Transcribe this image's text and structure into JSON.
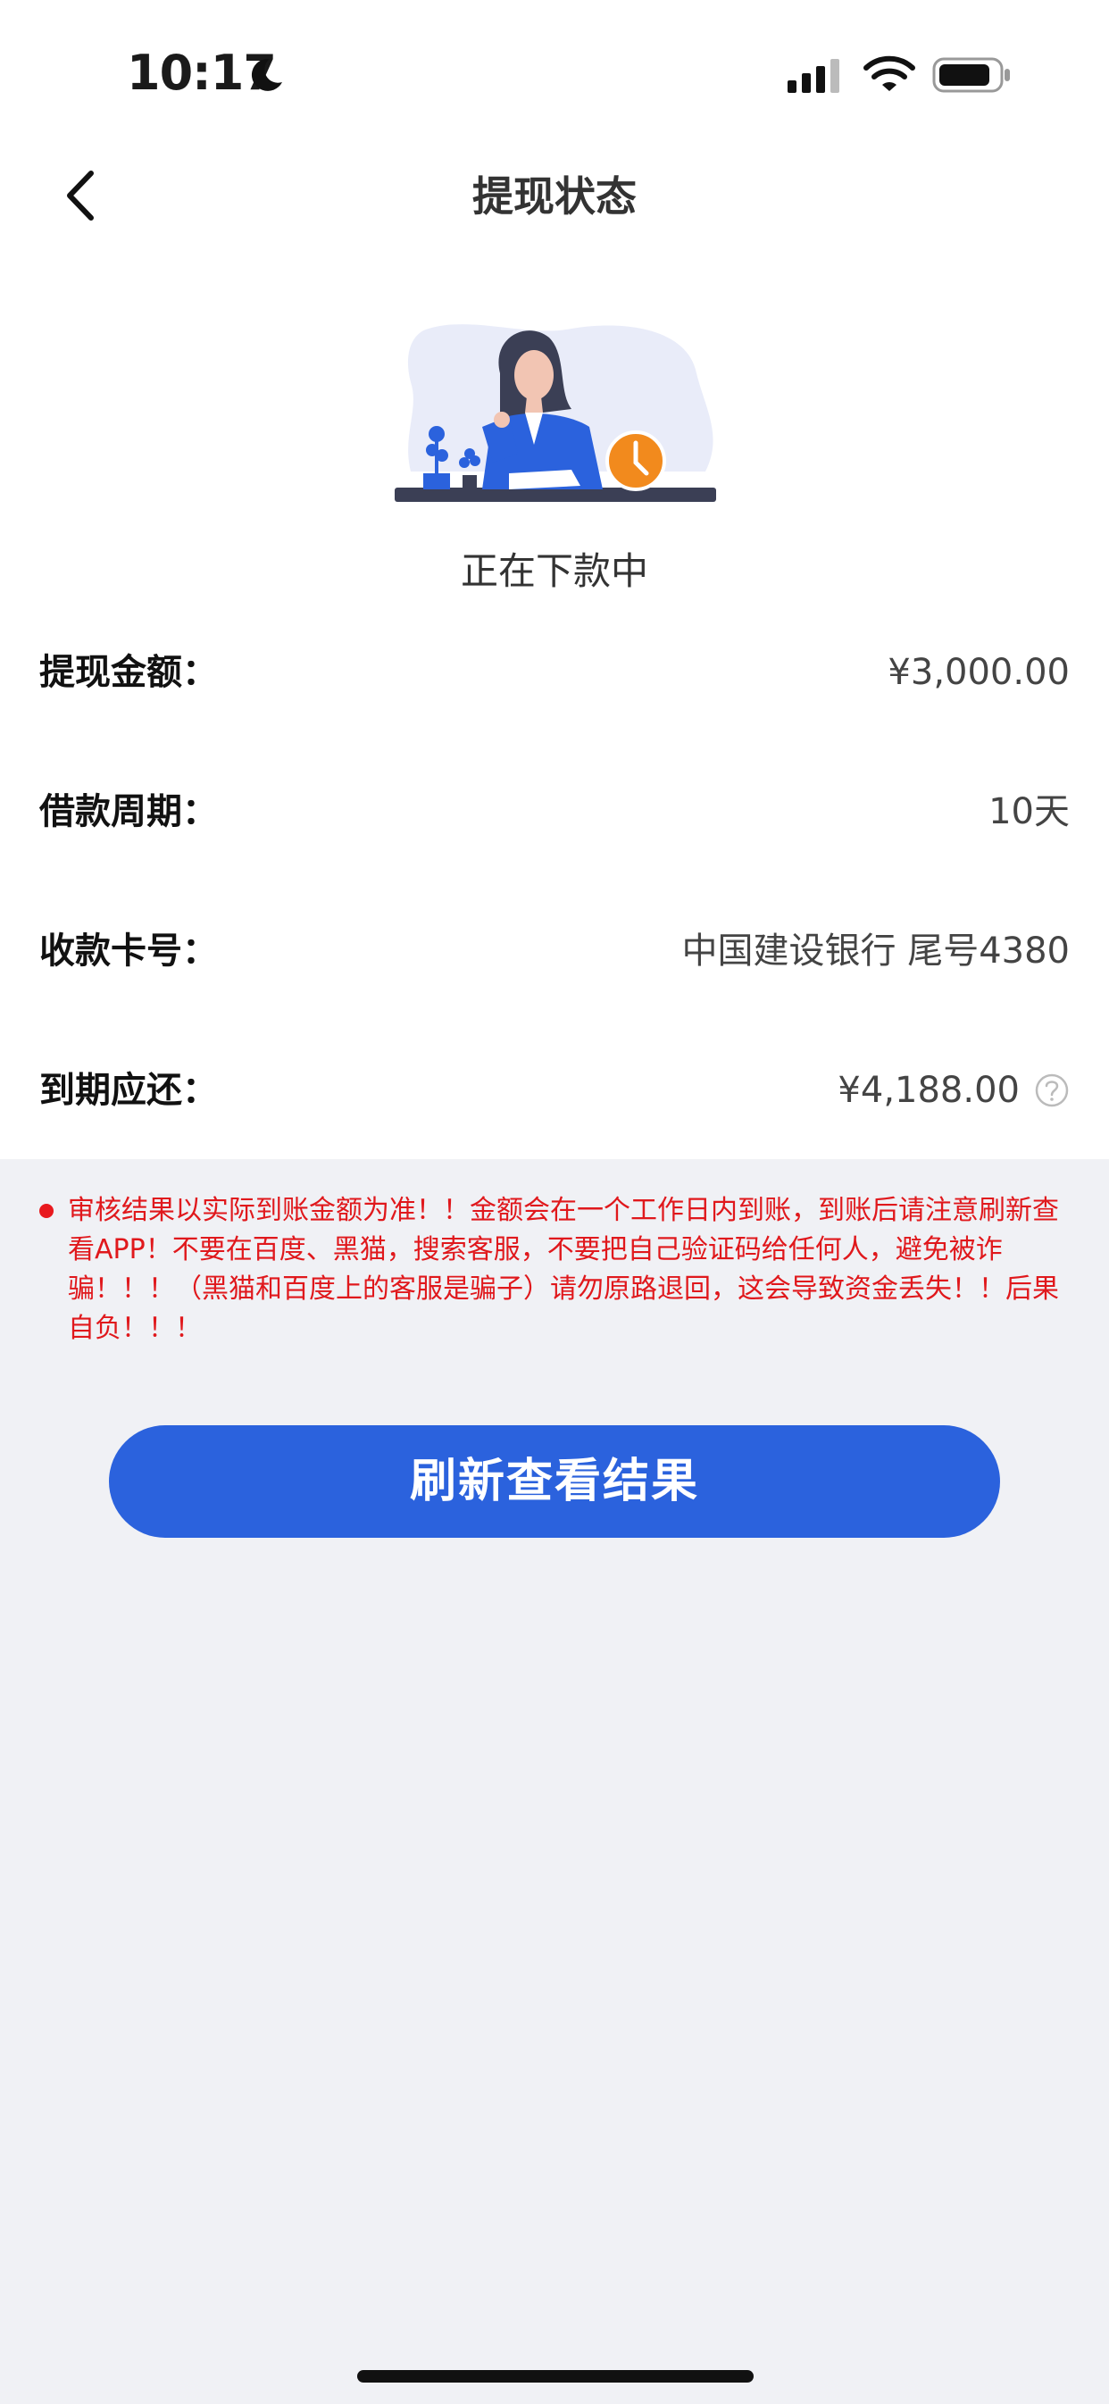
{
  "status_bar": {
    "time": "10:17"
  },
  "nav": {
    "title": "提现状态"
  },
  "status": {
    "text": "正在下款中"
  },
  "details": [
    {
      "label": "提现金额：",
      "value": "¥3,000.00"
    },
    {
      "label": "借款周期：",
      "value": "10天"
    },
    {
      "label": "收款卡号：",
      "value": "中国建设银行 尾号4380"
    },
    {
      "label": "到期应还：",
      "value": "¥4,188.00"
    }
  ],
  "notice": {
    "text": "审核结果以实际到账金额为准！！金额会在一个工作日内到账，到账后请注意刷新查看APP！不要在百度、黑猫，搜索客服，不要把自己验证码给任何人，避免被诈骗！！！（黑猫和百度上的客服是骗子）请勿原路退回，这会导致资金丢失！！后果自负！！！"
  },
  "button": {
    "label": "刷新查看结果"
  },
  "colors": {
    "primary": "#2b62dd",
    "warning": "#e0181c",
    "background": "#f0f1f5"
  },
  "icons": [
    "moon-icon",
    "cellular-signal-icon",
    "wifi-icon",
    "battery-icon",
    "back-chevron-icon",
    "help-question-icon"
  ]
}
